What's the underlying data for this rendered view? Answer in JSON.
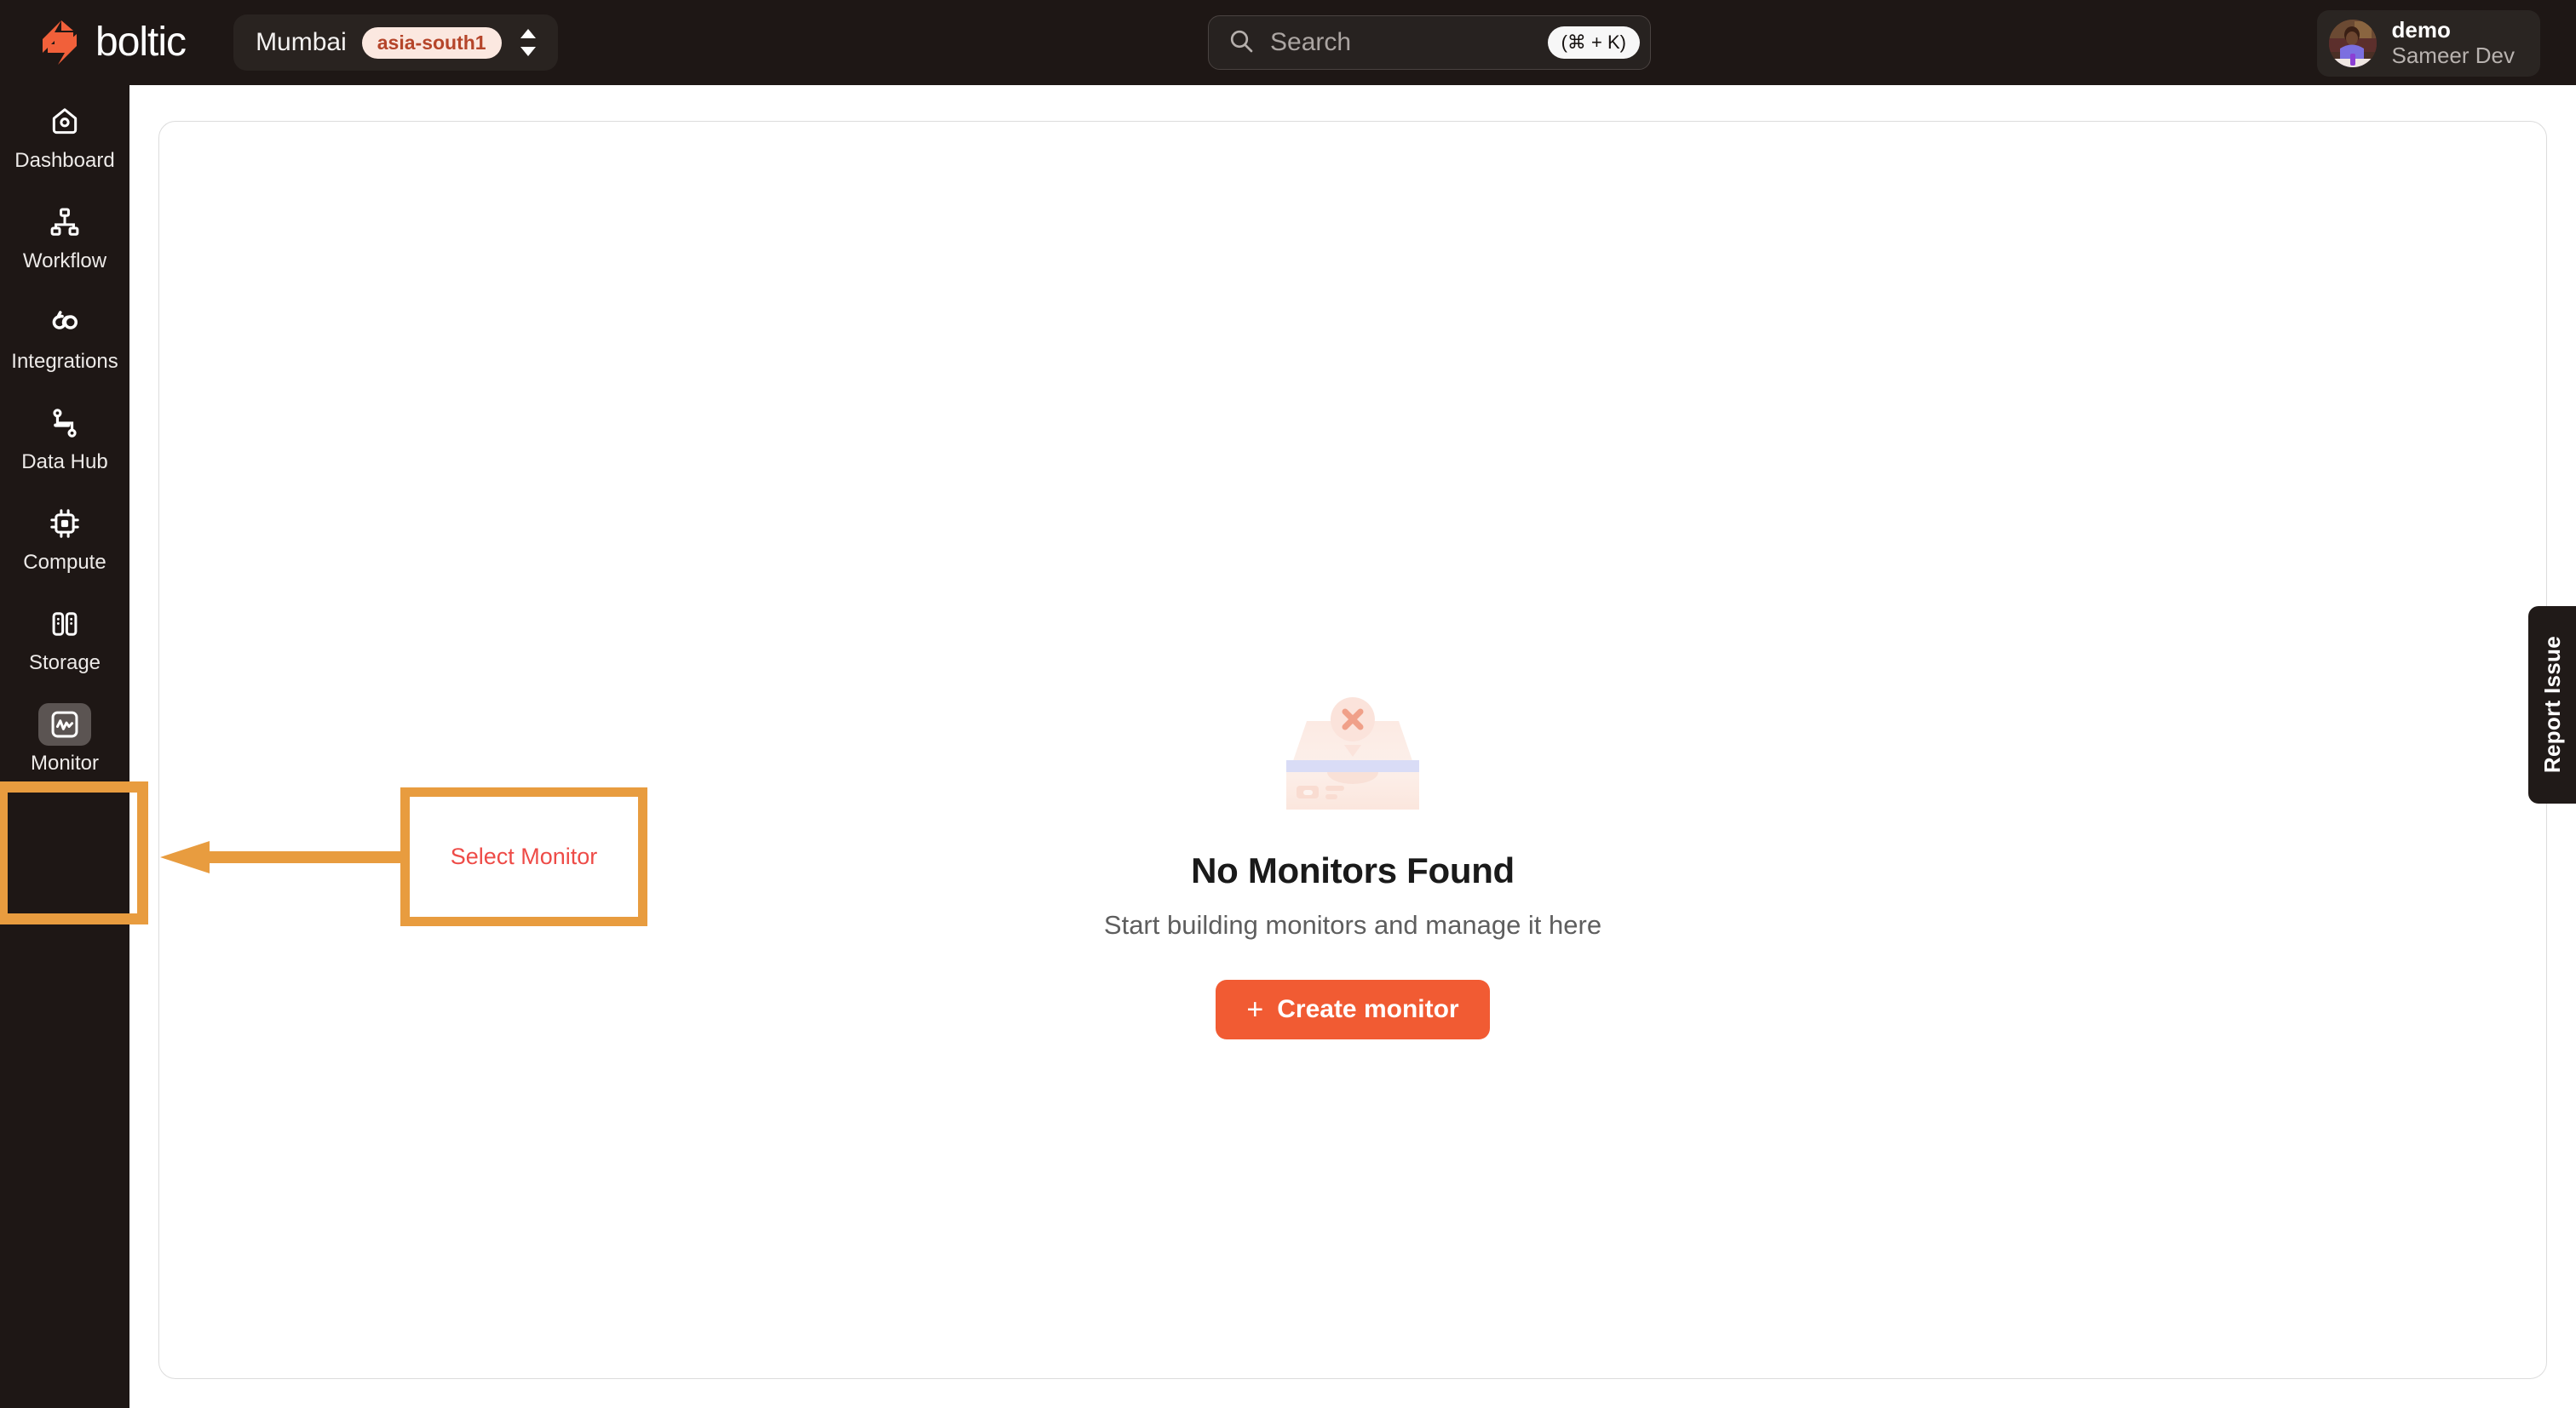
{
  "brand": {
    "name": "boltic",
    "logo_icon": "boltic-bolt-logo",
    "accent": "#F1603A"
  },
  "header": {
    "region": {
      "city": "Mumbai",
      "zone": "asia-south1",
      "chevron_icon": "chevron-up-down-icon"
    },
    "search": {
      "placeholder": "Search",
      "icon": "search-icon",
      "shortcut": "(⌘ + K)"
    },
    "profile": {
      "org": "demo",
      "user": "Sameer Dev",
      "avatar_icon": "user-avatar-photo"
    }
  },
  "sidebar": {
    "items": [
      {
        "label": "Dashboard",
        "icon": "home-dashboard-icon",
        "active": false
      },
      {
        "label": "Workflow",
        "icon": "workflow-nodes-icon",
        "active": false
      },
      {
        "label": "Integrations",
        "icon": "infinity-link-icon",
        "active": false
      },
      {
        "label": "Data Hub",
        "icon": "data-pipeline-icon",
        "active": false
      },
      {
        "label": "Compute",
        "icon": "cpu-chip-icon",
        "active": false
      },
      {
        "label": "Storage",
        "icon": "storage-drives-icon",
        "active": false
      },
      {
        "label": "Monitor",
        "icon": "monitor-activity-icon",
        "active": true
      }
    ]
  },
  "main": {
    "empty_state": {
      "illustration_icon": "empty-tray-error-illustration",
      "title": "No Monitors Found",
      "subtitle": "Start building monitors and manage it here",
      "button_label": "Create monitor",
      "button_icon": "plus-icon",
      "button_color": "#F15B33"
    }
  },
  "report_tab": {
    "label": "Report Issue"
  },
  "annotations": {
    "callout_label": "Select Monitor",
    "border_color": "#E89C3F",
    "text_color": "#EE4B47",
    "arrow_icon": "left-arrow-annotation"
  }
}
